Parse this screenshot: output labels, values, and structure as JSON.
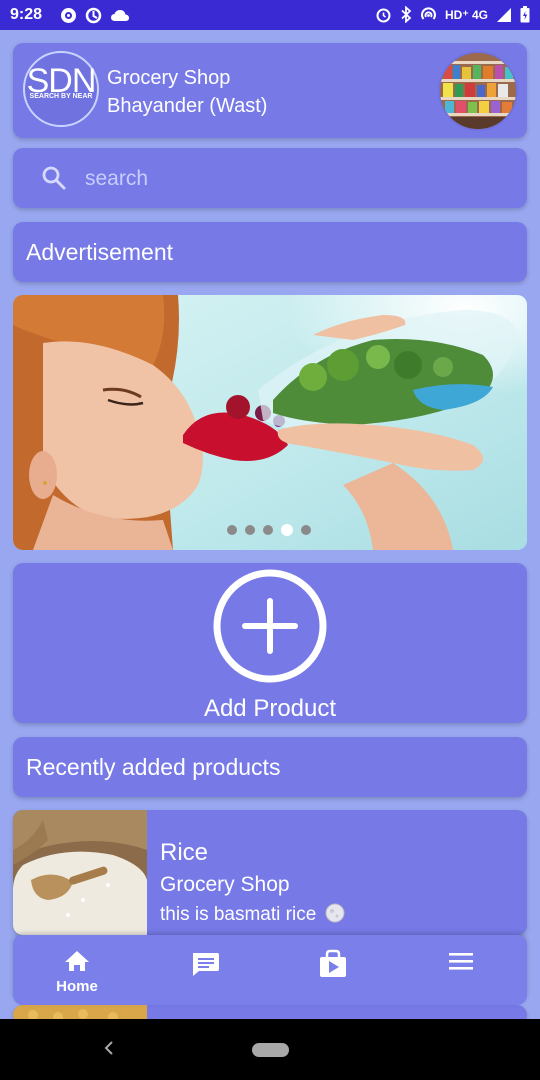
{
  "status_bar": {
    "time": "9:28",
    "network": "HD⁺ 4G"
  },
  "header": {
    "logo_text": "SDN",
    "logo_tagline": "SEARCH BY NEAR",
    "shop_name": "Grocery Shop",
    "location": "Bhayander (Wast)"
  },
  "search": {
    "placeholder": "search",
    "value": ""
  },
  "advertisement": {
    "title": "Advertisement",
    "slide_count": 5,
    "active_slide": 4
  },
  "add_product": {
    "label": "Add Product"
  },
  "recent": {
    "title": "Recently added products",
    "products": [
      {
        "name": "Rice",
        "shop": "Grocery Shop",
        "description": "this is basmati rice"
      }
    ]
  },
  "bottom_nav": {
    "items": [
      {
        "label": "Home",
        "icon": "home-icon",
        "active": true
      },
      {
        "label": "",
        "icon": "chat-icon",
        "active": false
      },
      {
        "label": "",
        "icon": "shop-bag-icon",
        "active": false
      },
      {
        "label": "",
        "icon": "menu-icon",
        "active": false
      }
    ]
  },
  "colors": {
    "status_bar": "#3a2ad4",
    "background": "#98a7ef",
    "card": "#7679e6",
    "text": "#ffffff"
  }
}
